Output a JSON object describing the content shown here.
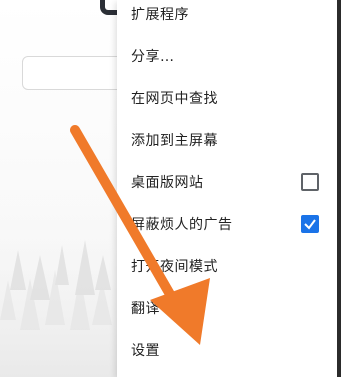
{
  "menu": {
    "items": [
      {
        "label": "扩展程序",
        "has_checkbox": false
      },
      {
        "label": "分享…",
        "has_checkbox": false
      },
      {
        "label": "在网页中查找",
        "has_checkbox": false
      },
      {
        "label": "添加到主屏幕",
        "has_checkbox": false
      },
      {
        "label": "桌面版网站",
        "has_checkbox": true,
        "checked": false
      },
      {
        "label": "屏蔽烦人的广告",
        "has_checkbox": true,
        "checked": true
      },
      {
        "label": "打开夜间模式",
        "has_checkbox": false
      },
      {
        "label": "翻译",
        "has_checkbox": false
      },
      {
        "label": "设置",
        "has_checkbox": false
      }
    ]
  },
  "colors": {
    "accent": "#1a73e8",
    "annotation_arrow": "#f07a2a"
  },
  "icons": {
    "checkbox_checked": "check-icon",
    "annotation": "arrow-annotation"
  }
}
